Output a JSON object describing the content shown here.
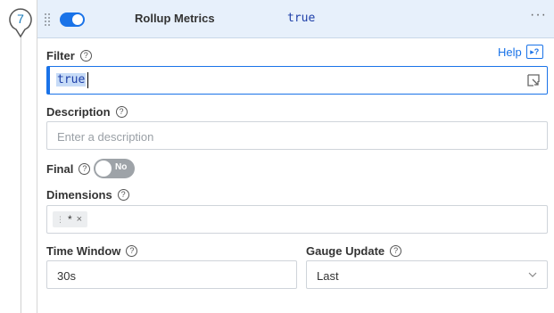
{
  "step": {
    "number": "7"
  },
  "header": {
    "title": "Rollup Metrics",
    "value": "true",
    "more_label": "···",
    "enabled": true
  },
  "help": {
    "label": "Help",
    "icon": "?"
  },
  "filter": {
    "label": "Filter",
    "help_icon": "?",
    "value": "true"
  },
  "description": {
    "label": "Description",
    "help_icon": "?",
    "placeholder": "Enter a description",
    "value": ""
  },
  "final": {
    "label": "Final",
    "help_icon": "?",
    "toggle_text": "No",
    "enabled": false
  },
  "dimensions": {
    "label": "Dimensions",
    "help_icon": "?",
    "tags": [
      {
        "label": "*",
        "remove": "×"
      }
    ]
  },
  "time_window": {
    "label": "Time Window",
    "help_icon": "?",
    "value": "30s"
  },
  "gauge_update": {
    "label": "Gauge Update",
    "help_icon": "?",
    "value": "Last"
  },
  "colors": {
    "accent": "#1a73e8",
    "header_bg": "#e7f0fb",
    "code_text": "#1e3fa8"
  }
}
